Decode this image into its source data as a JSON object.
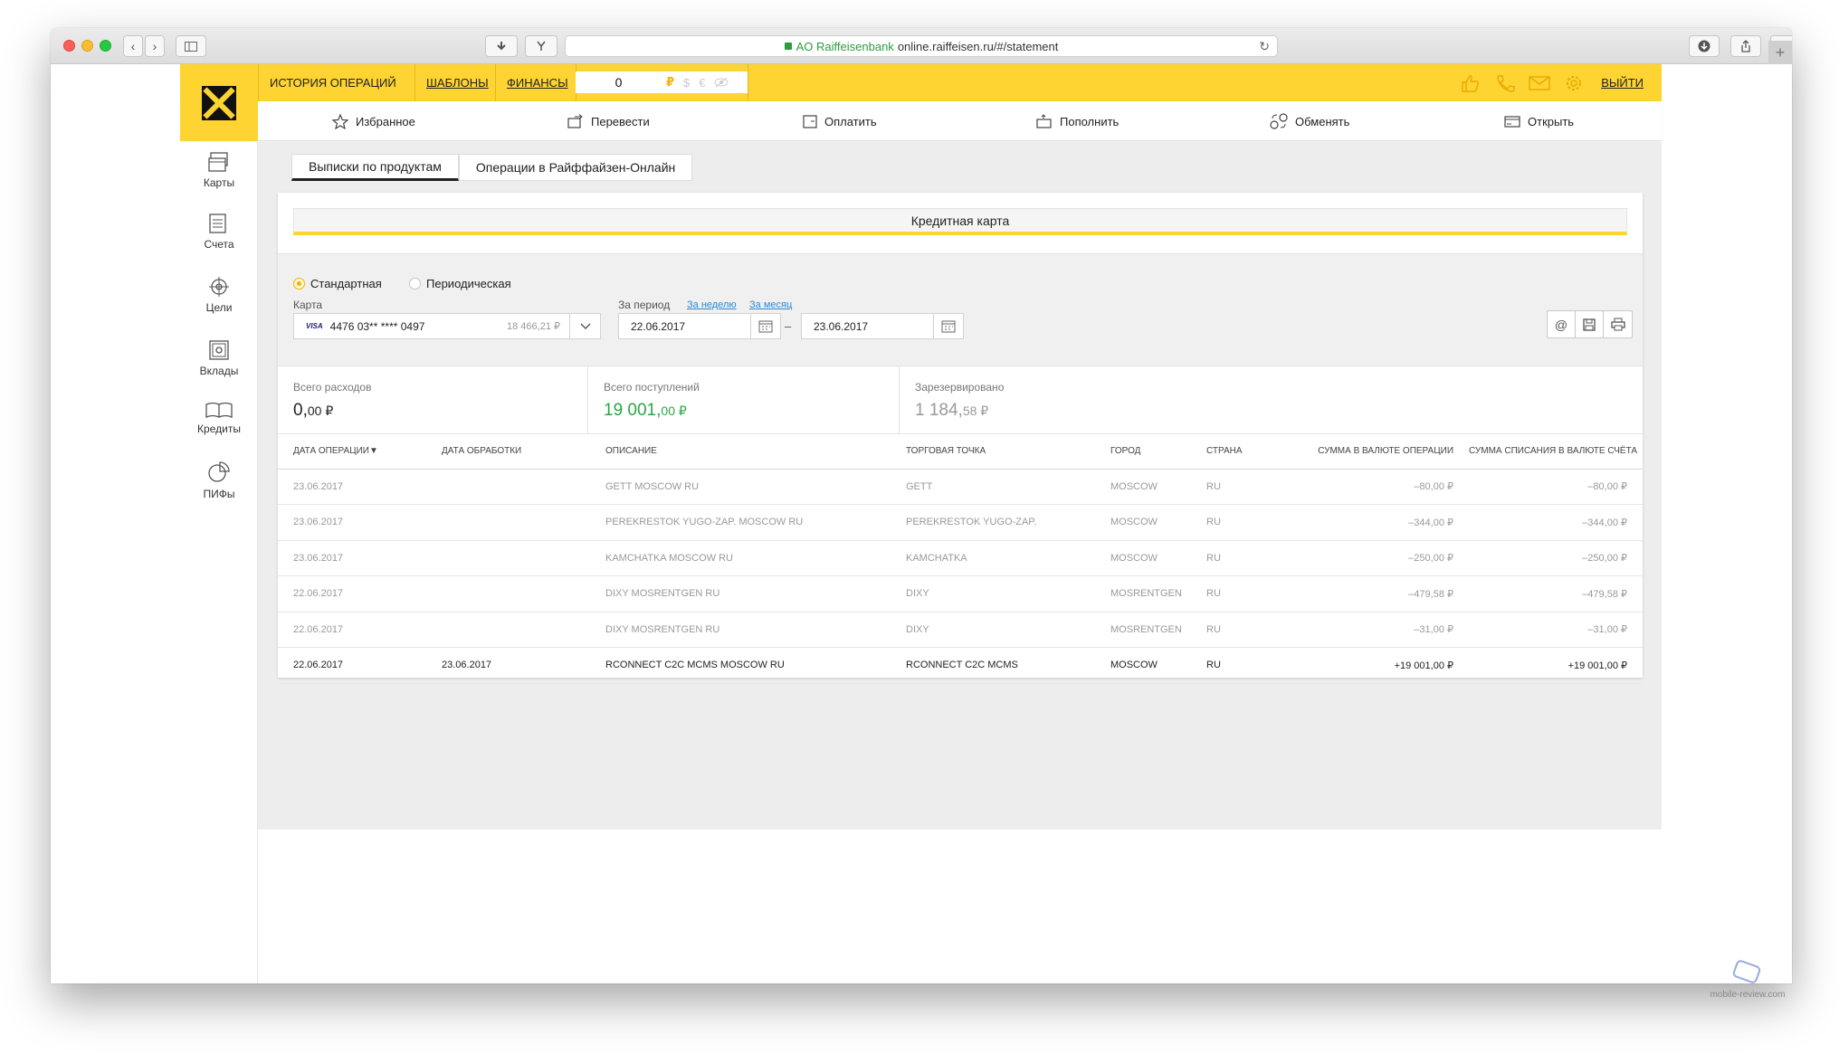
{
  "browser": {
    "url_host_prefix": "AO Raiffeisenbank",
    "url_host": "online.raiffeisen.ru",
    "url_path": "/#/statement"
  },
  "header": {
    "tabs": [
      "ИСТОРИЯ ОПЕРАЦИЙ",
      "ШАБЛОНЫ",
      "ФИНАНСЫ"
    ],
    "balance_value": "0",
    "currencies": [
      "₽",
      "$",
      "€"
    ],
    "logout": "ВЫЙТИ",
    "brand_color": "#fdd431"
  },
  "subnav": [
    "Избранное",
    "Перевести",
    "Оплатить",
    "Пополнить",
    "Обменять",
    "Открыть"
  ],
  "sidebar": [
    "Карты",
    "Счета",
    "Цели",
    "Вклады",
    "Кредиты",
    "ПИФы"
  ],
  "tabs": [
    "Выписки по продуктам",
    "Операции в Райффайзен-Онлайн"
  ],
  "product_title": "Кредитная карта",
  "filters": {
    "radio_standard": "Стандартная",
    "radio_periodic": "Периодическая",
    "card_label": "Карта",
    "card_brand": "VISA",
    "card_number": "4476 03** **** 0497",
    "card_balance": "18 466,21 ₽",
    "period_label": "За период",
    "link_week": "За неделю",
    "link_month": "За месяц",
    "date_from": "22.06.2017",
    "date_dash": "–",
    "date_to": "23.06.2017"
  },
  "summary": {
    "expenses_label": "Всего расходов",
    "expenses_main": "0,",
    "expenses_cents": "00 ₽",
    "income_label": "Всего поступлений",
    "income_main": "19 001,",
    "income_cents": "00 ₽",
    "reserved_label": "Зарезервировано",
    "reserved_main": "1 184,",
    "reserved_cents": "58 ₽"
  },
  "table": {
    "headers": [
      "Дата операции▼",
      "Дата обработки",
      "Описание",
      "Торговая точка",
      "Город",
      "Страна",
      "Сумма в валюте операции",
      "Сумма списания в валюте счёта"
    ],
    "rows": [
      [
        "23.06.2017",
        "",
        "GETT MOSCOW RU",
        "GETT",
        "MOSCOW",
        "RU",
        "–80,00 ₽",
        "–80,00 ₽"
      ],
      [
        "23.06.2017",
        "",
        "PEREKRESTOK YUGO-ZAP. MOSCOW RU",
        "PEREKRESTOK YUGO-ZAP.",
        "MOSCOW",
        "RU",
        "–344,00 ₽",
        "–344,00 ₽"
      ],
      [
        "23.06.2017",
        "",
        "KAMCHATKA MOSCOW RU",
        "KAMCHATKA",
        "MOSCOW",
        "RU",
        "–250,00 ₽",
        "–250,00 ₽"
      ],
      [
        "22.06.2017",
        "",
        "DIXY MOSRENTGEN RU",
        "DIXY",
        "MOSRENTGEN",
        "RU",
        "–479,58 ₽",
        "–479,58 ₽"
      ],
      [
        "22.06.2017",
        "",
        "DIXY MOSRENTGEN RU",
        "DIXY",
        "MOSRENTGEN",
        "RU",
        "–31,00 ₽",
        "–31,00 ₽"
      ],
      [
        "22.06.2017",
        "23.06.2017",
        "RCONNECT C2C MCMS MOSCOW RU",
        "RCONNECT C2C MCMS",
        "MOSCOW",
        "RU",
        "+19 001,00 ₽",
        "+19 001,00 ₽"
      ]
    ]
  },
  "watermark": "mobile-review.com"
}
